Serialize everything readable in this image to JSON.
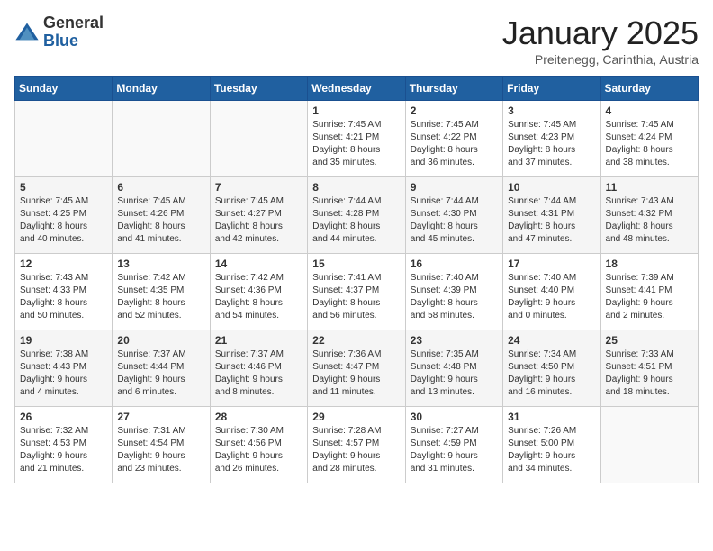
{
  "header": {
    "logo_general": "General",
    "logo_blue": "Blue",
    "title": "January 2025",
    "subtitle": "Preitenegg, Carinthia, Austria"
  },
  "weekdays": [
    "Sunday",
    "Monday",
    "Tuesday",
    "Wednesday",
    "Thursday",
    "Friday",
    "Saturday"
  ],
  "weeks": [
    [
      {
        "day": "",
        "info": ""
      },
      {
        "day": "",
        "info": ""
      },
      {
        "day": "",
        "info": ""
      },
      {
        "day": "1",
        "info": "Sunrise: 7:45 AM\nSunset: 4:21 PM\nDaylight: 8 hours\nand 35 minutes."
      },
      {
        "day": "2",
        "info": "Sunrise: 7:45 AM\nSunset: 4:22 PM\nDaylight: 8 hours\nand 36 minutes."
      },
      {
        "day": "3",
        "info": "Sunrise: 7:45 AM\nSunset: 4:23 PM\nDaylight: 8 hours\nand 37 minutes."
      },
      {
        "day": "4",
        "info": "Sunrise: 7:45 AM\nSunset: 4:24 PM\nDaylight: 8 hours\nand 38 minutes."
      }
    ],
    [
      {
        "day": "5",
        "info": "Sunrise: 7:45 AM\nSunset: 4:25 PM\nDaylight: 8 hours\nand 40 minutes."
      },
      {
        "day": "6",
        "info": "Sunrise: 7:45 AM\nSunset: 4:26 PM\nDaylight: 8 hours\nand 41 minutes."
      },
      {
        "day": "7",
        "info": "Sunrise: 7:45 AM\nSunset: 4:27 PM\nDaylight: 8 hours\nand 42 minutes."
      },
      {
        "day": "8",
        "info": "Sunrise: 7:44 AM\nSunset: 4:28 PM\nDaylight: 8 hours\nand 44 minutes."
      },
      {
        "day": "9",
        "info": "Sunrise: 7:44 AM\nSunset: 4:30 PM\nDaylight: 8 hours\nand 45 minutes."
      },
      {
        "day": "10",
        "info": "Sunrise: 7:44 AM\nSunset: 4:31 PM\nDaylight: 8 hours\nand 47 minutes."
      },
      {
        "day": "11",
        "info": "Sunrise: 7:43 AM\nSunset: 4:32 PM\nDaylight: 8 hours\nand 48 minutes."
      }
    ],
    [
      {
        "day": "12",
        "info": "Sunrise: 7:43 AM\nSunset: 4:33 PM\nDaylight: 8 hours\nand 50 minutes."
      },
      {
        "day": "13",
        "info": "Sunrise: 7:42 AM\nSunset: 4:35 PM\nDaylight: 8 hours\nand 52 minutes."
      },
      {
        "day": "14",
        "info": "Sunrise: 7:42 AM\nSunset: 4:36 PM\nDaylight: 8 hours\nand 54 minutes."
      },
      {
        "day": "15",
        "info": "Sunrise: 7:41 AM\nSunset: 4:37 PM\nDaylight: 8 hours\nand 56 minutes."
      },
      {
        "day": "16",
        "info": "Sunrise: 7:40 AM\nSunset: 4:39 PM\nDaylight: 8 hours\nand 58 minutes."
      },
      {
        "day": "17",
        "info": "Sunrise: 7:40 AM\nSunset: 4:40 PM\nDaylight: 9 hours\nand 0 minutes."
      },
      {
        "day": "18",
        "info": "Sunrise: 7:39 AM\nSunset: 4:41 PM\nDaylight: 9 hours\nand 2 minutes."
      }
    ],
    [
      {
        "day": "19",
        "info": "Sunrise: 7:38 AM\nSunset: 4:43 PM\nDaylight: 9 hours\nand 4 minutes."
      },
      {
        "day": "20",
        "info": "Sunrise: 7:37 AM\nSunset: 4:44 PM\nDaylight: 9 hours\nand 6 minutes."
      },
      {
        "day": "21",
        "info": "Sunrise: 7:37 AM\nSunset: 4:46 PM\nDaylight: 9 hours\nand 8 minutes."
      },
      {
        "day": "22",
        "info": "Sunrise: 7:36 AM\nSunset: 4:47 PM\nDaylight: 9 hours\nand 11 minutes."
      },
      {
        "day": "23",
        "info": "Sunrise: 7:35 AM\nSunset: 4:48 PM\nDaylight: 9 hours\nand 13 minutes."
      },
      {
        "day": "24",
        "info": "Sunrise: 7:34 AM\nSunset: 4:50 PM\nDaylight: 9 hours\nand 16 minutes."
      },
      {
        "day": "25",
        "info": "Sunrise: 7:33 AM\nSunset: 4:51 PM\nDaylight: 9 hours\nand 18 minutes."
      }
    ],
    [
      {
        "day": "26",
        "info": "Sunrise: 7:32 AM\nSunset: 4:53 PM\nDaylight: 9 hours\nand 21 minutes."
      },
      {
        "day": "27",
        "info": "Sunrise: 7:31 AM\nSunset: 4:54 PM\nDaylight: 9 hours\nand 23 minutes."
      },
      {
        "day": "28",
        "info": "Sunrise: 7:30 AM\nSunset: 4:56 PM\nDaylight: 9 hours\nand 26 minutes."
      },
      {
        "day": "29",
        "info": "Sunrise: 7:28 AM\nSunset: 4:57 PM\nDaylight: 9 hours\nand 28 minutes."
      },
      {
        "day": "30",
        "info": "Sunrise: 7:27 AM\nSunset: 4:59 PM\nDaylight: 9 hours\nand 31 minutes."
      },
      {
        "day": "31",
        "info": "Sunrise: 7:26 AM\nSunset: 5:00 PM\nDaylight: 9 hours\nand 34 minutes."
      },
      {
        "day": "",
        "info": ""
      }
    ]
  ]
}
